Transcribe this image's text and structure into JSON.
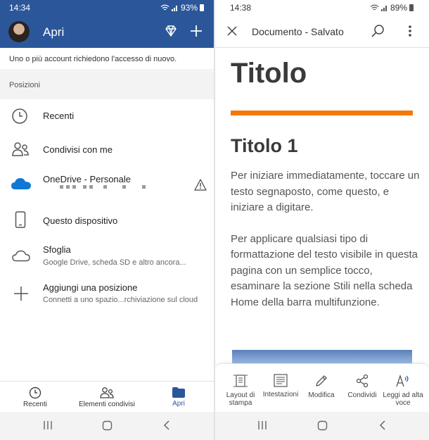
{
  "left": {
    "status": {
      "time": "14:34",
      "battery": "93%"
    },
    "header": {
      "title": "Apri"
    },
    "notice": "Uno o più account richiedono l'accesso di nuovo.",
    "section_label": "Posizioni",
    "locations": [
      {
        "label": "Recenti",
        "icon": "clock-icon"
      },
      {
        "label": "Condivisi con me",
        "icon": "people-icon"
      },
      {
        "label": "OneDrive - Personale",
        "icon": "onedrive-cloud-icon",
        "warning": true
      },
      {
        "label": "Questo dispositivo",
        "icon": "phone-icon"
      },
      {
        "label": "Sfoglia",
        "sublabel": "Google Drive, scheda SD e altro ancora...",
        "icon": "cloud-outline-icon"
      },
      {
        "label": "Aggiungi una posizione",
        "sublabel": "Connetti a uno spazio...rchiviazione sul cloud",
        "icon": "plus-icon"
      }
    ],
    "nav": [
      {
        "label": "Recenti",
        "icon": "clock-icon"
      },
      {
        "label": "Elementi condivisi",
        "icon": "people-icon"
      },
      {
        "label": "Apri",
        "icon": "folder-icon",
        "active": true
      }
    ]
  },
  "right": {
    "status": {
      "time": "14:38",
      "battery": "89%"
    },
    "header": {
      "title": "Documento - Salvato"
    },
    "document": {
      "title": "Titolo",
      "heading1": "Titolo 1",
      "paragraphs": [
        "Per iniziare immediatamente, toccare un testo segnaposto, come questo, e iniziare a digitare.",
        "Per applicare qualsiasi tipo di formattazione del testo visibile in questa pagina con un semplice tocco, esaminare la sezione Stili nella scheda Home della barra multifunzione."
      ]
    },
    "toolbar": [
      {
        "label": "Layout di stampa",
        "icon": "print-layout-icon"
      },
      {
        "label": "Intestazioni",
        "icon": "headings-icon"
      },
      {
        "label": "Modifica",
        "icon": "pencil-icon"
      },
      {
        "label": "Condividi",
        "icon": "share-icon"
      },
      {
        "label": "Leggi ad alta voce",
        "icon": "read-aloud-icon"
      }
    ]
  },
  "colors": {
    "brand": "#2b579a",
    "accent_rule": "#f4780b",
    "onedrive": "#0f78d4",
    "active_nav": "#2b579a"
  }
}
